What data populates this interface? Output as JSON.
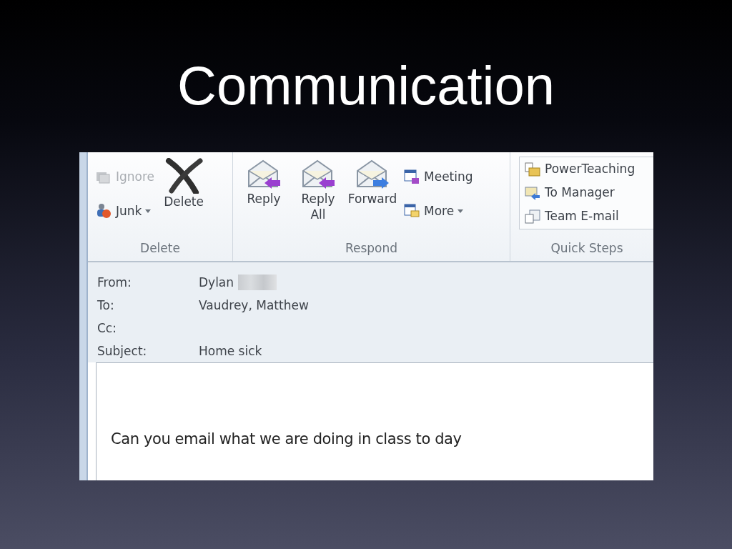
{
  "slide_title": "Communication",
  "ribbon": {
    "groups": [
      {
        "label": "Delete",
        "items": [
          {
            "kind": "stack",
            "buttons": [
              {
                "label": "Ignore",
                "disabled": true,
                "dropdown": false
              },
              {
                "label": "Junk",
                "disabled": false,
                "dropdown": true
              }
            ]
          },
          {
            "kind": "large",
            "label": "Delete"
          }
        ]
      },
      {
        "label": "Respond",
        "items": [
          {
            "kind": "large",
            "label": "Reply"
          },
          {
            "kind": "large",
            "label": "Reply All"
          },
          {
            "kind": "large",
            "label": "Forward"
          },
          {
            "kind": "stack",
            "buttons": [
              {
                "label": "Meeting",
                "disabled": false,
                "dropdown": false
              },
              {
                "label": "More",
                "disabled": false,
                "dropdown": true
              }
            ]
          }
        ]
      },
      {
        "label": "Quick Steps",
        "items": [
          {
            "kind": "gallery",
            "entries": [
              "PowerTeaching",
              "To Manager",
              "Team E-mail"
            ]
          }
        ]
      }
    ]
  },
  "header": [
    {
      "label": "From:",
      "value": "Dylan",
      "redacted": true
    },
    {
      "label": "To:",
      "value": "Vaudrey, Matthew"
    },
    {
      "label": "Cc:"
    },
    {
      "label": "Subject:",
      "value": "Home sick"
    }
  ],
  "body": "Can you email what we are doing in class to day"
}
